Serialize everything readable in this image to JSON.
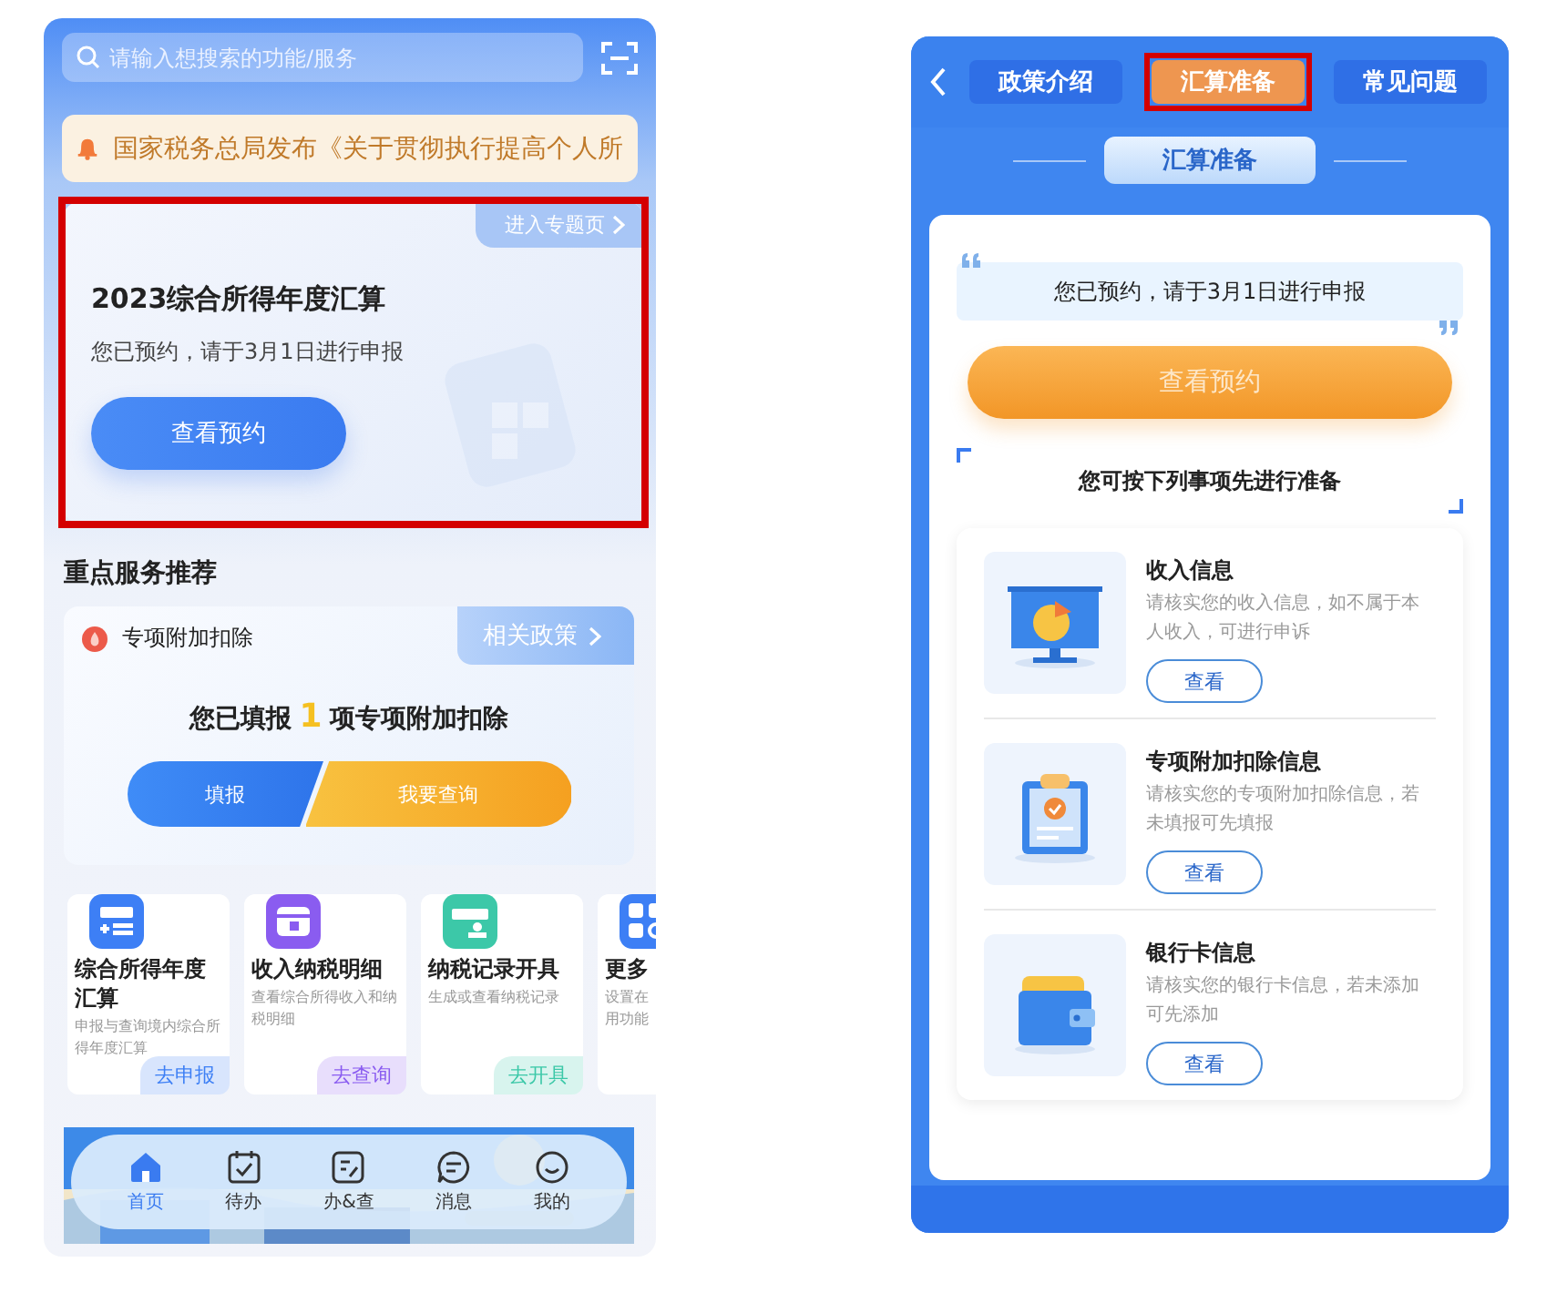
{
  "home": {
    "search": {
      "placeholder": "请输入想搜索的功能/服务"
    },
    "notice": {
      "text": "国家税务总局发布《关于贯彻执行提高个人所"
    },
    "banner": {
      "highlighted": true,
      "link": "进入专题页",
      "title": "2023综合所得年度汇算",
      "subtitle": "您已预约，请于3月1日进行申报",
      "button": "查看预约"
    },
    "section_title": "重点服务推荐",
    "deduction": {
      "title": "专项附加扣除",
      "link": "相关政策",
      "summary_before": "您已填报",
      "count": "1",
      "summary_after": "项专项附加扣除",
      "buttons": [
        {
          "label": "填报",
          "kind": "primary"
        },
        {
          "label": "我要查询",
          "kind": "secondary"
        }
      ]
    },
    "services": [
      {
        "kind": "declare",
        "color": "#3d7ff5",
        "title": "综合所得年度汇算",
        "description": "申报与查询境内综合所得年度汇算",
        "action": "去申报"
      },
      {
        "kind": "detail",
        "color": "#8a5cf0",
        "title": "收入纳税明细",
        "description": "查看综合所得收入和纳税明细",
        "action": "去查询"
      },
      {
        "kind": "record",
        "color": "#3cc8a8",
        "title": "纳税记录开具",
        "description": "生成或查看纳税记录",
        "action": "去开具"
      },
      {
        "kind": "more",
        "color": "#3d7ff5",
        "title": "更多",
        "description": "设置在用功能"
      }
    ],
    "nav": [
      {
        "kind": "home",
        "label": "首页",
        "selected": true
      },
      {
        "kind": "todo",
        "label": "待办",
        "selected": false
      },
      {
        "kind": "handle",
        "label": "办&查",
        "selected": false
      },
      {
        "kind": "message",
        "label": "消息",
        "selected": false
      },
      {
        "kind": "mine",
        "label": "我的",
        "selected": false
      }
    ]
  },
  "prep": {
    "tabs": [
      {
        "label": "政策介绍",
        "selected": false,
        "highlighted": false
      },
      {
        "label": "汇算准备",
        "selected": true,
        "highlighted": true
      },
      {
        "label": "常见问题",
        "selected": false,
        "highlighted": false
      }
    ],
    "section_title": "汇算准备",
    "notice": "您已预约，请于3月1日进行申报",
    "button": "查看预约",
    "hint": "您可按下列事项先进行准备",
    "items": [
      {
        "kind": "income",
        "title": "收入信息",
        "description": "请核实您的收入信息，如不属于本人收入，可进行申诉",
        "button": "查看"
      },
      {
        "kind": "deduction",
        "title": "专项附加扣除信息",
        "description": "请核实您的专项附加扣除信息，若未填报可先填报",
        "button": "查看"
      },
      {
        "kind": "bank",
        "title": "银行卡信息",
        "description": "请核实您的银行卡信息，若未添加可先添加",
        "button": "查看"
      }
    ]
  }
}
